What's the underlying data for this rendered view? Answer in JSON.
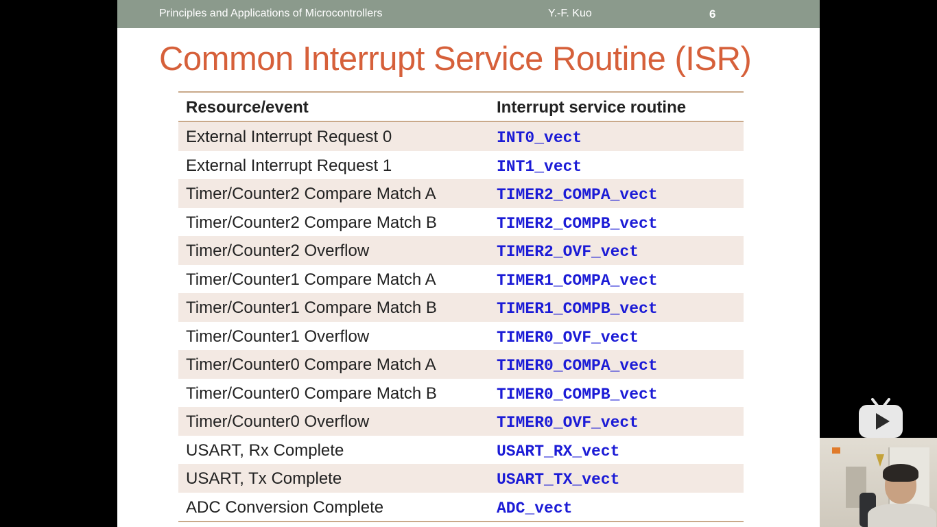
{
  "header": {
    "course": "Principles and Applications of Microcontrollers",
    "author": "Y.-F. Kuo",
    "page": "6"
  },
  "title": "Common Interrupt Service Routine (ISR)",
  "table": {
    "columns": [
      "Resource/event",
      "Interrupt service routine"
    ],
    "rows": [
      {
        "resource": "External Interrupt Request 0",
        "isr": "INT0_vect"
      },
      {
        "resource": "External Interrupt Request 1",
        "isr": "INT1_vect"
      },
      {
        "resource": "Timer/Counter2 Compare Match A",
        "isr": "TIMER2_COMPA_vect"
      },
      {
        "resource": "Timer/Counter2 Compare Match B",
        "isr": "TIMER2_COMPB_vect"
      },
      {
        "resource": "Timer/Counter2 Overflow",
        "isr": "TIMER2_OVF_vect"
      },
      {
        "resource": "Timer/Counter1 Compare Match A",
        "isr": "TIMER1_COMPA_vect"
      },
      {
        "resource": "Timer/Counter1 Compare Match B",
        "isr": "TIMER1_COMPB_vect"
      },
      {
        "resource": "Timer/Counter1 Overflow",
        "isr": "TIMER0_OVF_vect"
      },
      {
        "resource": "Timer/Counter0 Compare Match A",
        "isr": "TIMER0_COMPA_vect"
      },
      {
        "resource": "Timer/Counter0 Compare Match B",
        "isr": "TIMER0_COMPB_vect"
      },
      {
        "resource": "Timer/Counter0 Overflow",
        "isr": "TIMER0_OVF_vect"
      },
      {
        "resource": "USART, Rx Complete",
        "isr": "USART_RX_vect"
      },
      {
        "resource": "USART, Tx Complete",
        "isr": "USART_TX_vect"
      },
      {
        "resource": "ADC Conversion Complete",
        "isr": "ADC_vect"
      }
    ]
  },
  "overlay": {
    "play_icon": "play-logo-icon"
  },
  "colors": {
    "title": "#d6603a",
    "header_bar": "#8b9a8c",
    "isr_text": "#1b1bd6",
    "row_shade": "#f3e9e3",
    "rule": "#c9a98a"
  }
}
